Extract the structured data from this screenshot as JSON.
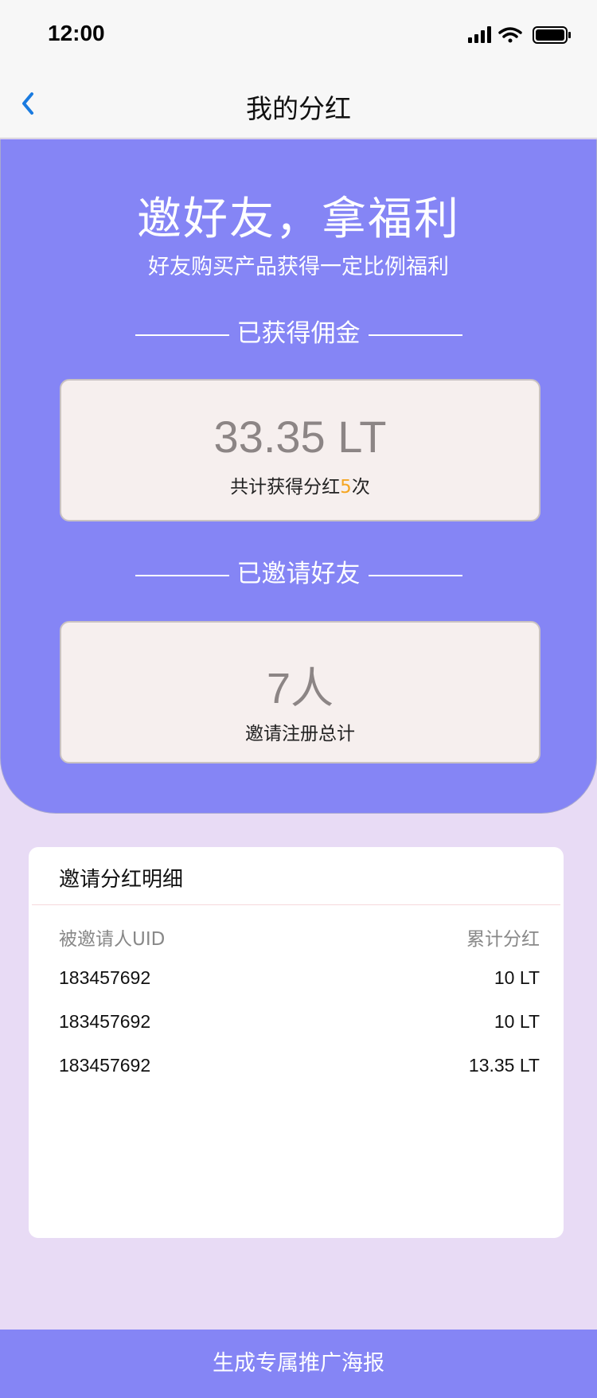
{
  "status_bar": {
    "time": "12:00"
  },
  "nav": {
    "title": "我的分红"
  },
  "hero": {
    "title": "邀好友，拿福利",
    "subtitle": "好友购买产品获得一定比例福利",
    "commission_heading": "已获得佣金",
    "commission_value": "33.35 LT",
    "commission_desc_prefix": "共计获得分红",
    "commission_count": "5",
    "commission_desc_suffix": "次",
    "invited_heading": "已邀请好友",
    "invited_value": "7人",
    "invited_desc": "邀请注册总计"
  },
  "detail": {
    "title": "邀请分红明细",
    "headers": [
      "被邀请人UID",
      "累计分红"
    ],
    "rows": [
      {
        "uid": "183457692",
        "amount": "10 LT"
      },
      {
        "uid": "183457692",
        "amount": "10 LT"
      },
      {
        "uid": "183457692",
        "amount": "13.35 LT"
      }
    ]
  },
  "footer": {
    "button_label": "生成专属推广海报"
  },
  "colors": {
    "accent": "#8585f5",
    "page_bg": "#e8dbf5",
    "highlight": "#f5a623",
    "back_arrow": "#1a7be0"
  }
}
